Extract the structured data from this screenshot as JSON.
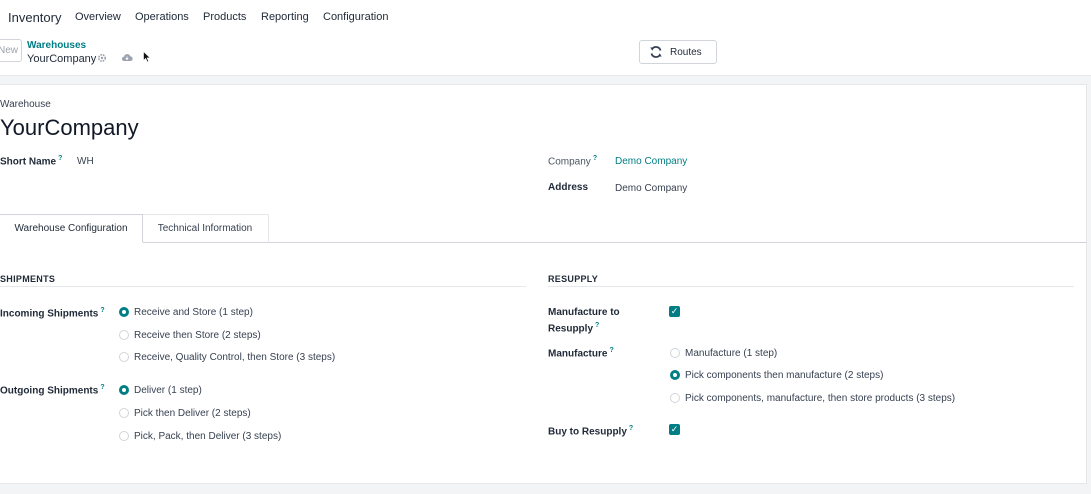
{
  "nav": {
    "app_name": "Inventory",
    "items": [
      "Overview",
      "Operations",
      "Products",
      "Reporting",
      "Configuration"
    ]
  },
  "control": {
    "new_label": "New",
    "breadcrumb_parent": "Warehouses",
    "breadcrumb_current": "YourCompany",
    "routes_label": "Routes"
  },
  "form": {
    "kind_label": "Warehouse",
    "title": "YourCompany",
    "short_name_label": "Short Name",
    "short_name_value": "WH",
    "company_label": "Company",
    "company_value": "Demo Company",
    "address_label": "Address",
    "address_value": "Demo Company",
    "help_mark": "?"
  },
  "tabs": {
    "active": "Warehouse Configuration",
    "other": "Technical Information"
  },
  "shipments": {
    "title": "SHIPMENTS",
    "incoming_label": "Incoming Shipments",
    "incoming_options": [
      "Receive and Store (1 step)",
      "Receive then Store (2 steps)",
      "Receive, Quality Control, then Store (3 steps)"
    ],
    "incoming_selected": 0,
    "outgoing_label": "Outgoing Shipments",
    "outgoing_options": [
      "Deliver (1 step)",
      "Pick then Deliver (2 steps)",
      "Pick, Pack, then Deliver (3 steps)"
    ],
    "outgoing_selected": 0
  },
  "resupply": {
    "title": "RESUPPLY",
    "manufacture_to_resupply_label_1": "Manufacture to",
    "manufacture_to_resupply_label_2": "Resupply",
    "manufacture_to_resupply_checked": true,
    "manufacture_label": "Manufacture",
    "manufacture_options": [
      "Manufacture (1 step)",
      "Pick components then manufacture (2 steps)",
      "Pick components, manufacture, then store products (3 steps)"
    ],
    "manufacture_selected": 1,
    "buy_label": "Buy to Resupply",
    "buy_checked": true
  },
  "colors": {
    "accent": "#017e84",
    "text": "#1f2937",
    "muted": "#9ca3af"
  }
}
